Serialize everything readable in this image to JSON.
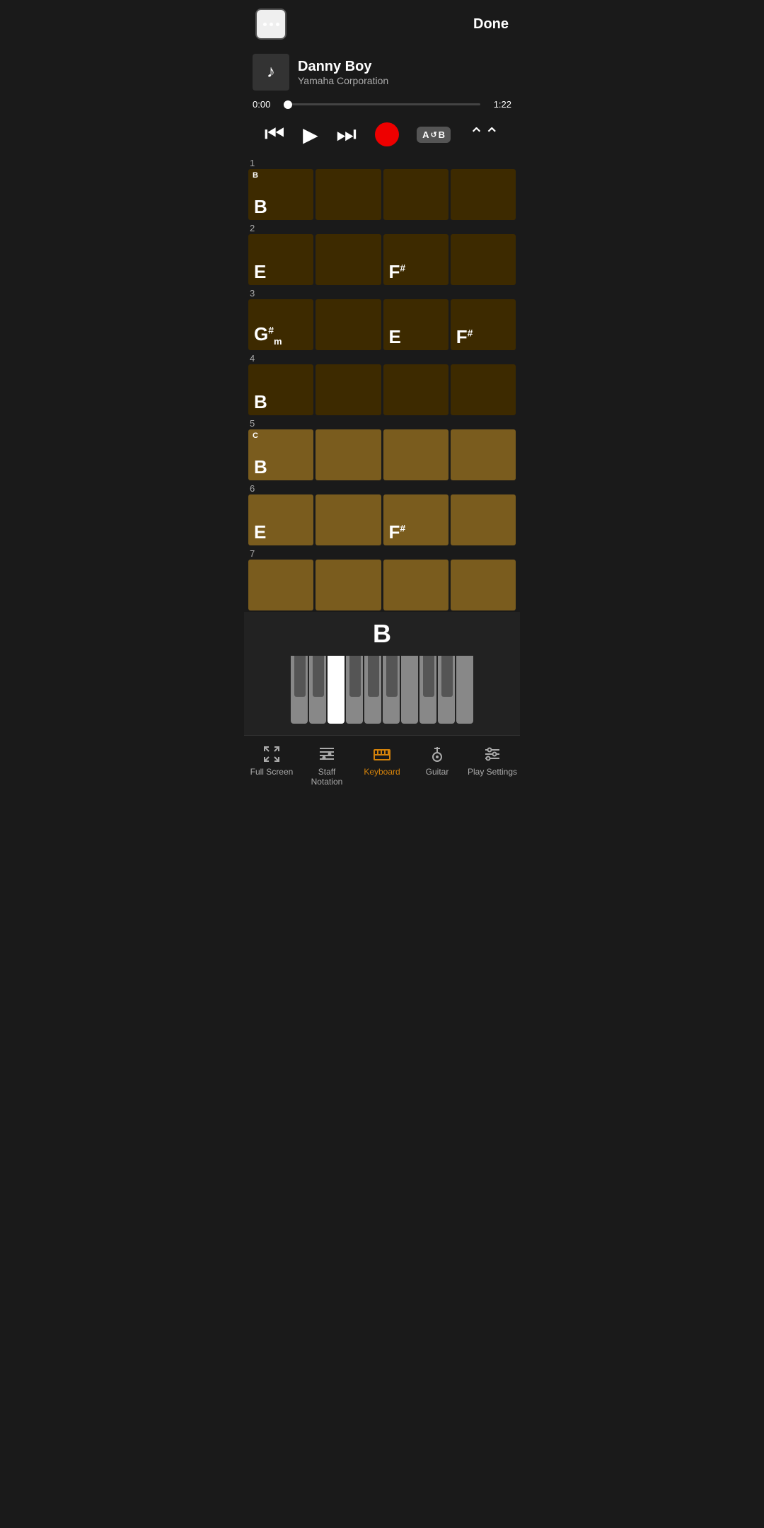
{
  "header": {
    "menu_label": "...",
    "done_label": "Done"
  },
  "song": {
    "title": "Danny Boy",
    "artist": "Yamaha Corporation",
    "time_current": "0:00",
    "time_total": "1:22",
    "progress_pct": 2
  },
  "controls": {
    "rewind_label": "Rewind",
    "play_label": "Play",
    "fast_forward_label": "Fast Forward",
    "record_label": "Record",
    "ab_label": "A↺B",
    "repeat_label": "Repeat"
  },
  "bars": [
    {
      "number": "1",
      "section": "B",
      "cells": [
        {
          "chord": "B",
          "style": "dark",
          "section_marker": "B"
        },
        {
          "chord": "",
          "style": "dark"
        },
        {
          "chord": "",
          "style": "dark"
        },
        {
          "chord": "",
          "style": "dark"
        }
      ]
    },
    {
      "number": "2",
      "cells": [
        {
          "chord": "E",
          "style": "dark"
        },
        {
          "chord": "",
          "style": "dark"
        },
        {
          "chord": "F#",
          "style": "dark",
          "sharp": true
        },
        {
          "chord": "",
          "style": "dark"
        }
      ]
    },
    {
      "number": "3",
      "cells": [
        {
          "chord": "G#m",
          "style": "dark",
          "sharp": true,
          "minor": true
        },
        {
          "chord": "",
          "style": "dark"
        },
        {
          "chord": "E",
          "style": "dark"
        },
        {
          "chord": "F#",
          "style": "dark",
          "sharp": true
        }
      ]
    },
    {
      "number": "4",
      "cells": [
        {
          "chord": "B",
          "style": "dark"
        },
        {
          "chord": "",
          "style": "dark"
        },
        {
          "chord": "",
          "style": "dark"
        },
        {
          "chord": "",
          "style": "dark"
        }
      ]
    },
    {
      "number": "5",
      "section": "C",
      "cells": [
        {
          "chord": "B",
          "style": "medium",
          "section_marker": "C"
        },
        {
          "chord": "",
          "style": "medium"
        },
        {
          "chord": "",
          "style": "medium"
        },
        {
          "chord": "",
          "style": "medium"
        }
      ]
    },
    {
      "number": "6",
      "cells": [
        {
          "chord": "E",
          "style": "medium"
        },
        {
          "chord": "",
          "style": "medium"
        },
        {
          "chord": "F#",
          "style": "medium",
          "sharp": true
        },
        {
          "chord": "",
          "style": "medium"
        }
      ]
    },
    {
      "number": "7",
      "cells": [
        {
          "chord": "",
          "style": "medium"
        },
        {
          "chord": "",
          "style": "medium"
        },
        {
          "chord": "",
          "style": "medium"
        },
        {
          "chord": "",
          "style": "medium"
        }
      ]
    }
  ],
  "piano": {
    "current_note": "B"
  },
  "nav": {
    "items": [
      {
        "id": "fullscreen",
        "label": "Full Screen",
        "active": false
      },
      {
        "id": "staff",
        "label": "Staff\nNotation",
        "active": false
      },
      {
        "id": "keyboard",
        "label": "Keyboard",
        "active": true
      },
      {
        "id": "guitar",
        "label": "Guitar",
        "active": false
      },
      {
        "id": "play_settings",
        "label": "Play Settings",
        "active": false
      }
    ]
  }
}
